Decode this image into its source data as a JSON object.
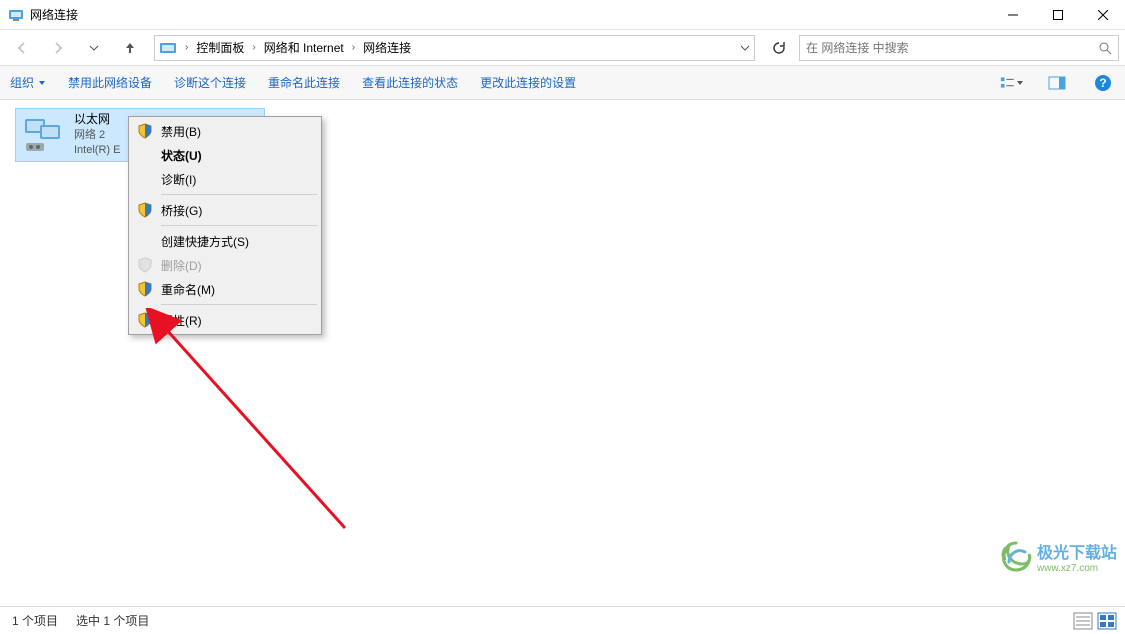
{
  "window": {
    "title": "网络连接"
  },
  "breadcrumb": {
    "items": [
      "控制面板",
      "网络和 Internet",
      "网络连接"
    ]
  },
  "search": {
    "placeholder": "在 网络连接 中搜索"
  },
  "toolbar": {
    "organize": "组织",
    "actions": [
      "禁用此网络设备",
      "诊断这个连接",
      "重命名此连接",
      "查看此连接的状态",
      "更改此连接的设置"
    ]
  },
  "network_item": {
    "name": "以太网",
    "network": "网络 2",
    "adapter": "Intel(R) E"
  },
  "context_menu": {
    "disable": "禁用(B)",
    "status": "状态(U)",
    "diagnose": "诊断(I)",
    "bridge": "桥接(G)",
    "create_shortcut": "创建快捷方式(S)",
    "delete": "删除(D)",
    "rename": "重命名(M)",
    "properties": "属性(R)"
  },
  "statusbar": {
    "count": "1 个项目",
    "selected": "选中 1 个项目"
  },
  "watermark": {
    "title": "极光下载站",
    "url": "www.xz7.com"
  }
}
